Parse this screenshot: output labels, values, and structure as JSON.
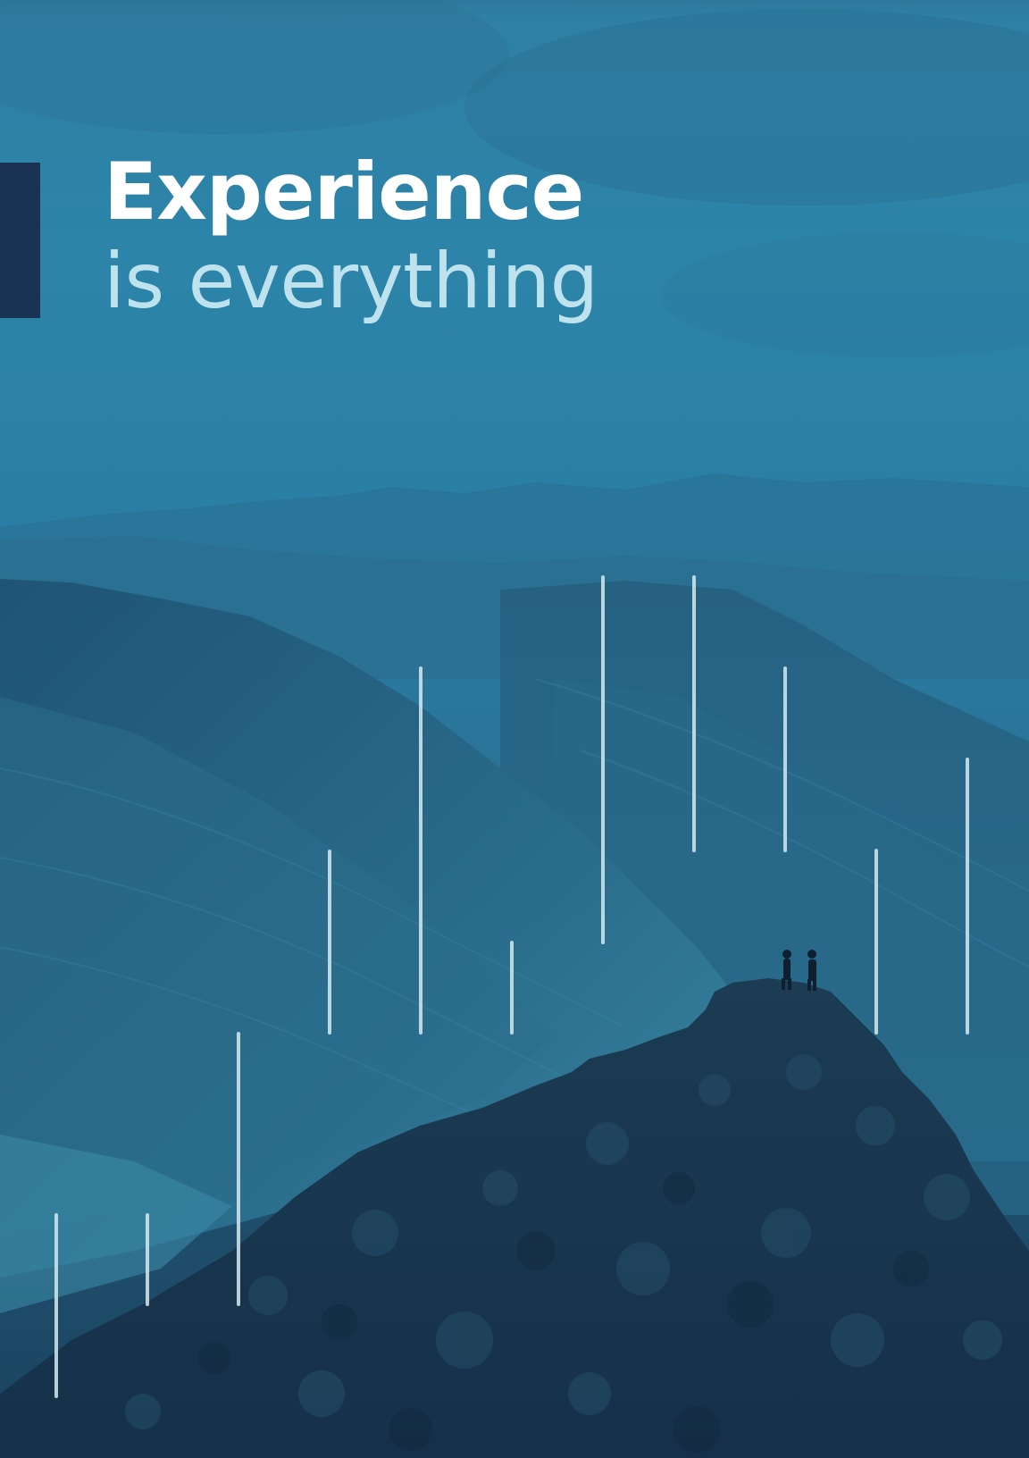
{
  "headline": {
    "line1": "Experience",
    "line2": "is everything"
  },
  "colors": {
    "accent_bar": "#1a3355",
    "headline_primary": "#ffffff",
    "headline_secondary": "#bfe3ee",
    "decorative_lines": "#d6e9ef"
  },
  "background_image": "mountain-landscape-with-two-hikers"
}
